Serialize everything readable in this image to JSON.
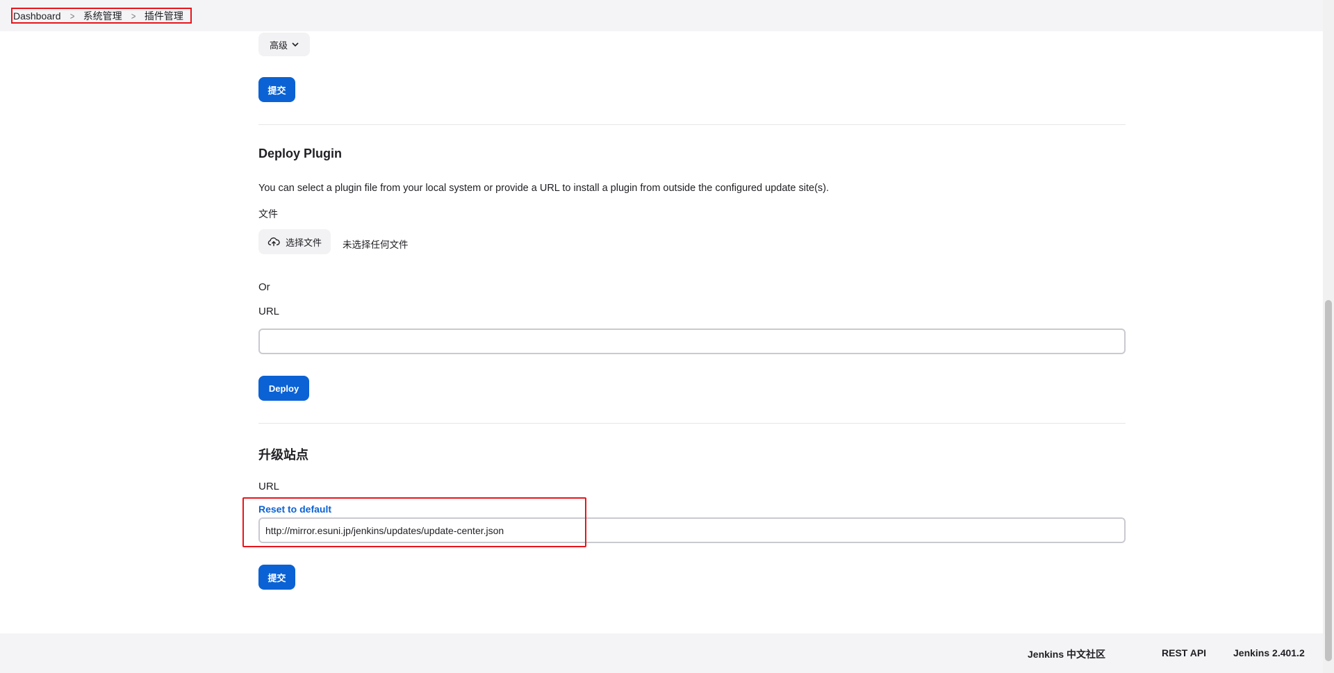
{
  "breadcrumb": {
    "items": [
      "Dashboard",
      "系统管理",
      "插件管理"
    ]
  },
  "advanced_section": {
    "advanced_label": "高级",
    "submit_label": "提交"
  },
  "deploy_plugin": {
    "title": "Deploy Plugin",
    "description": "You can select a plugin file from your local system or provide a URL to install a plugin from outside the configured update site(s).",
    "file_label": "文件",
    "choose_file_label": "选择文件",
    "no_file_text": "未选择任何文件",
    "or_text": "Or",
    "url_label": "URL",
    "url_value": "",
    "deploy_label": "Deploy"
  },
  "update_site": {
    "title": "升级站点",
    "url_label": "URL",
    "reset_label": "Reset to default",
    "url_value": "http://mirror.esuni.jp/jenkins/updates/update-center.json",
    "submit_label": "提交"
  },
  "footer": {
    "community": "Jenkins 中文社区",
    "rest_api": "REST API",
    "version": "Jenkins 2.401.2"
  },
  "colors": {
    "primary": "#0b62d4",
    "highlight": "#e8141b"
  }
}
